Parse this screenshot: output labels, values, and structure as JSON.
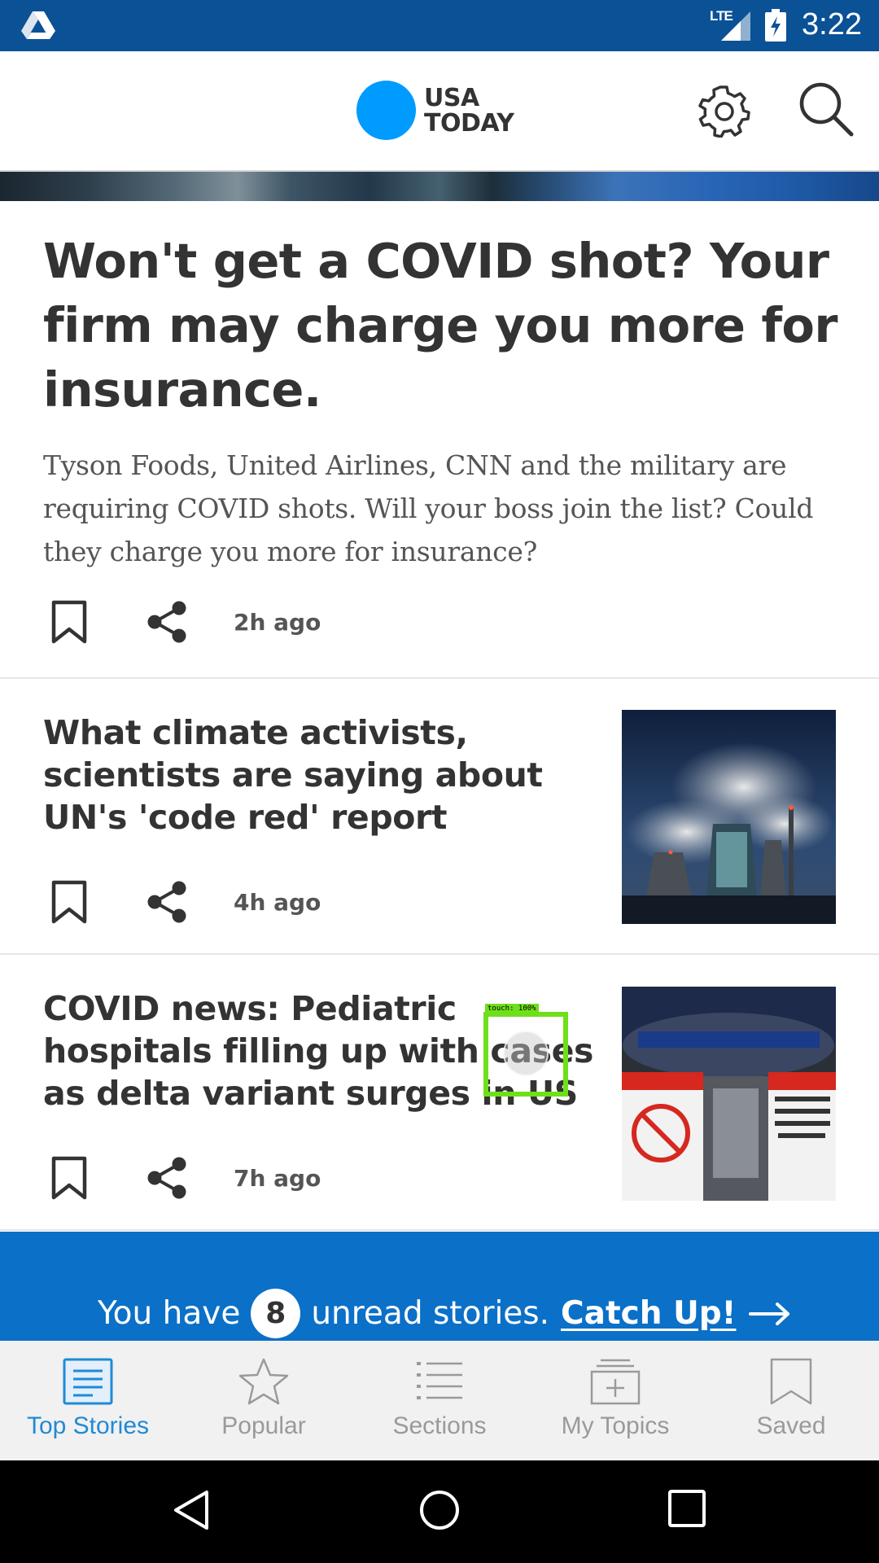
{
  "status_bar": {
    "network": "LTE",
    "time": "3:22"
  },
  "header": {
    "logo_line1": "USA",
    "logo_line2": "TODAY",
    "brand_color": "#009bff"
  },
  "lead_story": {
    "title": "Won't get a COVID shot? Your firm may charge you more for insurance.",
    "summary": "Tyson Foods, United Airlines, CNN and the military are requiring COVID shots. Will your boss join the list? Could they charge you more for insurance?",
    "time_ago": "2h ago"
  },
  "stories": [
    {
      "title": "What climate activists, scientists are saying about UN's 'code red' report",
      "time_ago": "4h ago"
    },
    {
      "title": "COVID news: Pediatric hospitals filling up with cases as delta variant surges in US",
      "time_ago": "7h ago"
    }
  ],
  "touch_overlay": {
    "label": "touch: 100%"
  },
  "unread_banner": {
    "prefix": "You have",
    "count": "8",
    "suffix": "unread stories.",
    "cta": "Catch Up!",
    "background": "#0b70c8"
  },
  "bottom_nav": {
    "tabs": [
      {
        "label": "Top Stories",
        "icon": "top-stories-icon",
        "active": true
      },
      {
        "label": "Popular",
        "icon": "star-icon",
        "active": false
      },
      {
        "label": "Sections",
        "icon": "list-icon",
        "active": false
      },
      {
        "label": "My Topics",
        "icon": "topics-icon",
        "active": false
      },
      {
        "label": "Saved",
        "icon": "bookmark-icon",
        "active": false
      }
    ],
    "active_color": "#1f8ad6"
  }
}
